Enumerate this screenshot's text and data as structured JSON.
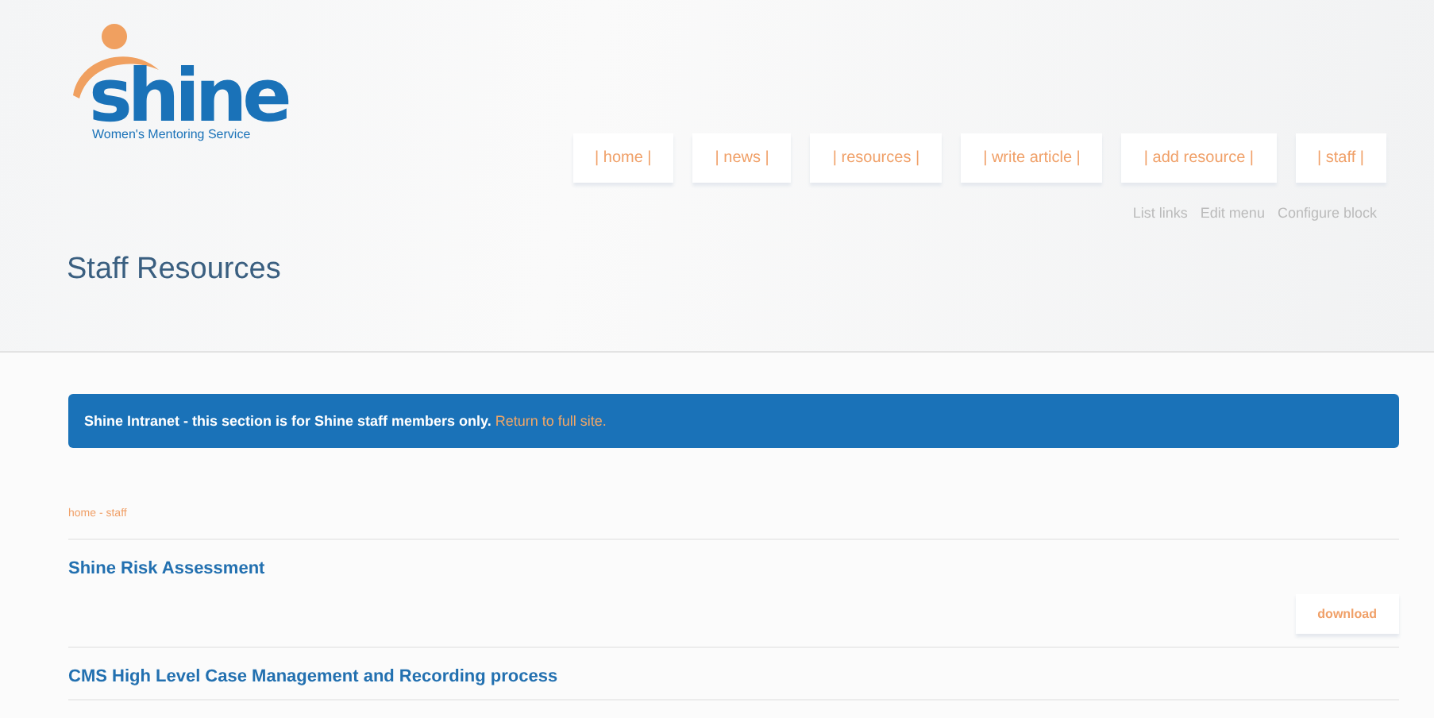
{
  "logo": {
    "name": "shine",
    "tagline": "Women's Mentoring Service"
  },
  "nav": [
    {
      "label": "| home |"
    },
    {
      "label": "| news |"
    },
    {
      "label": "| resources |"
    },
    {
      "label": "| write article |"
    },
    {
      "label": "| add resource |"
    },
    {
      "label": "| staff |"
    }
  ],
  "block_links": [
    "List links",
    "Edit menu",
    "Configure block"
  ],
  "page_title": "Staff Resources",
  "notice": {
    "text": "**Shine Intranet - this section is for Shine staff members only.**",
    "link": "Return to full site."
  },
  "breadcrumb": "home - staff",
  "resources": [
    {
      "title": "Shine Risk Assessment",
      "action": "download"
    },
    {
      "title": "CMS High Level Case Management and Recording process"
    }
  ]
}
